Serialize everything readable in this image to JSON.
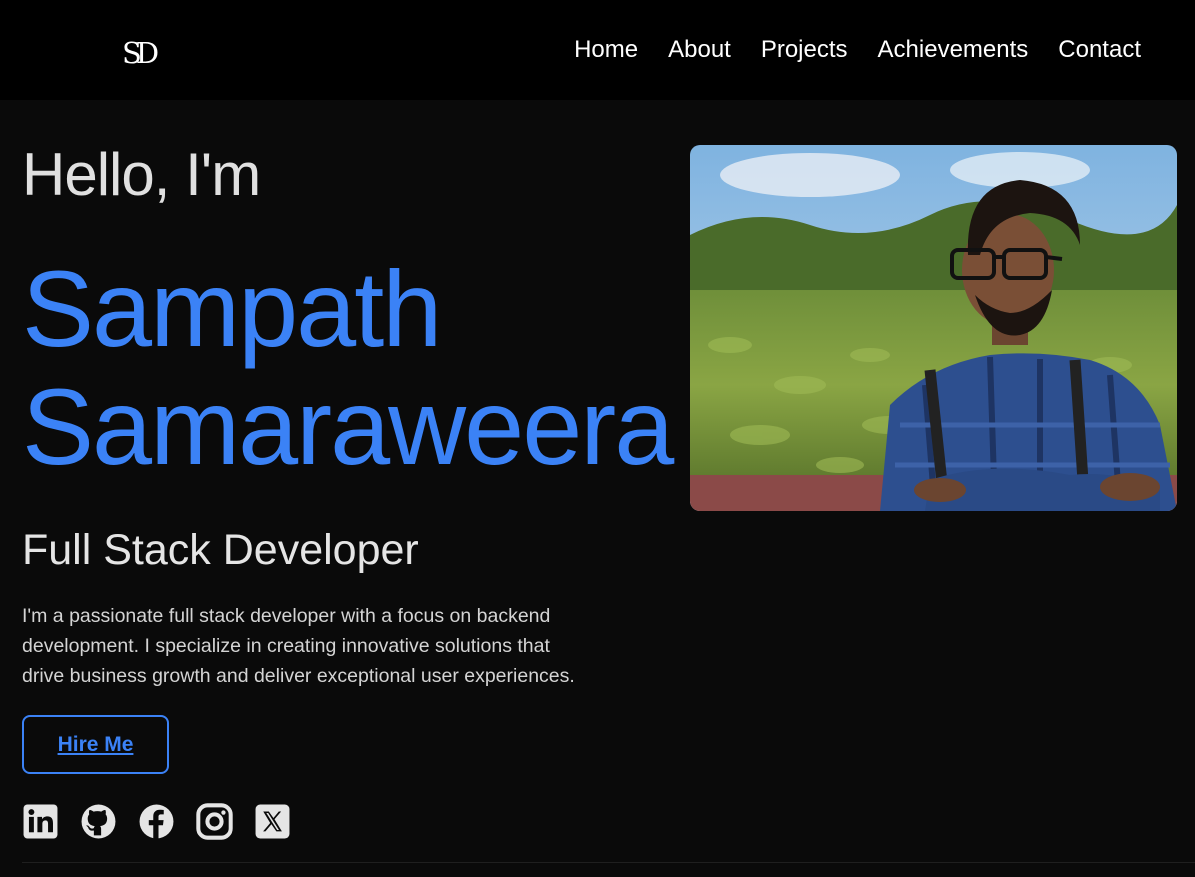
{
  "header": {
    "logo_text": "SD",
    "nav": [
      {
        "label": "Home"
      },
      {
        "label": "About"
      },
      {
        "label": "Projects"
      },
      {
        "label": "Achievements"
      },
      {
        "label": "Contact"
      }
    ]
  },
  "hero": {
    "greeting": "Hello, I'm",
    "first_name": "Sampath",
    "last_name": "Samaraweera",
    "role": "Full Stack Developer",
    "bio": "I'm a passionate full stack developer with a focus on backend development. I specialize in creating innovative solutions that drive business growth and deliver exceptional user experiences.",
    "hire_label": "Hire Me",
    "accent_color": "#3b82f6"
  },
  "socials": [
    {
      "icon": "linkedin-icon"
    },
    {
      "icon": "github-icon"
    },
    {
      "icon": "facebook-icon"
    },
    {
      "icon": "instagram-icon"
    },
    {
      "icon": "x-icon"
    }
  ],
  "profile_photo": {
    "icon": "profile-photo"
  }
}
